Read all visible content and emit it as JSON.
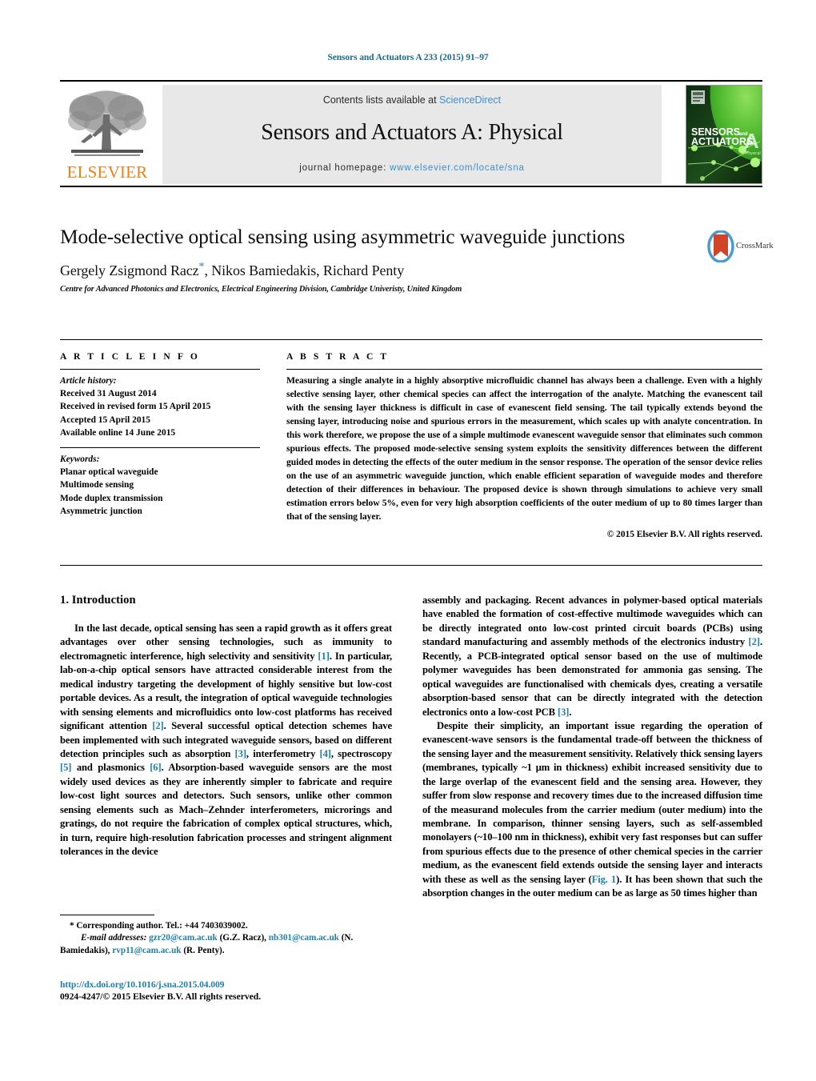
{
  "running_head": "Sensors and Actuators A 233 (2015) 91–97",
  "masthead": {
    "publisher_name": "ELSEVIER",
    "contents_prefix": "Contents lists available at ",
    "contents_link": "ScienceDirect",
    "journal_title": "Sensors and Actuators A: Physical",
    "homepage_label": "journal homepage: ",
    "homepage_url": "www.elsevier.com/locate/sna",
    "cover_line1": "SENSORS",
    "cover_and": "and",
    "cover_line2": "ACTUATORS",
    "cover_letter": "A",
    "cover_sub": "Physical",
    "accent_link_color": "#3e8ecc",
    "elsevier_orange": "#f07f1a"
  },
  "article": {
    "title": "Mode-selective optical sensing using asymmetric waveguide junctions",
    "authors": "Gergely Zsigmond Racz",
    "author_star": "*",
    "authors_rest": ", Nikos Bamiedakis, Richard Penty",
    "affiliation": "Centre for Advanced Photonics and Electronics, Electrical Engineering Division, Cambridge Univeristy, United Kingdom",
    "crossmark_label": "CrossMark"
  },
  "article_info": {
    "heading": "A R T I C L E   I N F O",
    "history_label": "Article history:",
    "history": [
      "Received 31 August 2014",
      "Received in revised form 15 April 2015",
      "Accepted 15 April 2015",
      "Available online 14 June 2015"
    ],
    "keywords_label": "Keywords:",
    "keywords": [
      "Planar optical waveguide",
      "Multimode sensing",
      "Mode duplex transmission",
      "Asymmetric junction"
    ]
  },
  "abstract": {
    "heading": "A B S T R A C T",
    "text": "Measuring a single analyte in a highly absorptive microfluidic channel has always been a challenge. Even with a highly selective sensing layer, other chemical species can affect the interrogation of the analyte. Matching the evanescent tail with the sensing layer thickness is difficult in case of evanescent field sensing. The tail typically extends beyond the sensing layer, introducing noise and spurious errors in the measurement, which scales up with analyte concentration. In this work therefore, we propose the use of a simple multimode evanescent waveguide sensor that eliminates such common spurious effects. The proposed mode-selective sensing system exploits the sensitivity differences between the different guided modes in detecting the effects of the outer medium in the sensor response. The operation of the sensor device relies on the use of an asymmetric waveguide junction, which enable efficient separation of waveguide modes and therefore detection of their differences in behaviour. The proposed device is shown through simulations to achieve very small estimation errors below 5%, even for very high absorption coefficients of the outer medium of up to 80 times larger than that of the sensing layer.",
    "copyright": "© 2015 Elsevier B.V. All rights reserved."
  },
  "body": {
    "section_heading": "1.  Introduction",
    "left_para_1_a": "In the last decade, optical sensing has seen a rapid growth as it offers great advantages over other sensing technologies, such as immunity to electromagnetic interference, high selectivity and sensitivity ",
    "ref1": "[1]",
    "left_para_1_b": ". In particular, lab-on-a-chip optical sensors have attracted considerable interest from the medical industry targeting the development of highly sensitive but low-cost portable devices. As a result, the integration of optical waveguide technologies with sensing elements and microfluidics onto low-cost platforms has received significant attention ",
    "ref2": "[2]",
    "left_para_1_c": ". Several successful optical detection schemes have been implemented with such integrated waveguide sensors, based on different detection principles such as absorption ",
    "ref3": "[3]",
    "left_para_1_d": ", interferometry ",
    "ref4": "[4]",
    "left_para_1_e": ", spectroscopy ",
    "ref5": "[5]",
    "left_para_1_f": " and plasmonics ",
    "ref6": "[6]",
    "left_para_1_g": ". Absorption-based waveguide sensors are the most widely used devices as they are inherently simpler to fabricate and require low-cost light sources and detectors. Such sensors, unlike other common sensing elements such as Mach–Zehnder interferometers, microrings and gratings, do not require the fabrication of complex optical structures, which, in turn, require high-resolution fabrication processes and stringent alignment tolerances in the device",
    "right_para_1_a": "assembly and packaging. Recent advances in polymer-based optical materials have enabled the formation of cost-effective multimode waveguides which can be directly integrated onto low-cost printed circuit boards (PCBs) using standard manufacturing and assembly methods of the electronics industry ",
    "right_ref2": "[2]",
    "right_para_1_b": ". Recently, a PCB-integrated optical sensor based on the use of multimode polymer waveguides has been demonstrated for ammonia gas sensing. The optical waveguides are functionalised with chemicals dyes, creating a versatile absorption-based sensor that can be directly integrated with the detection electronics onto a low-cost PCB ",
    "right_ref3": "[3]",
    "right_para_1_c": ".",
    "right_para_2_a": "Despite their simplicity, an important issue regarding the operation of evanescent-wave sensors is the fundamental trade-off between the thickness of the sensing layer and the measurement sensitivity. Relatively thick sensing layers (membranes, typically ~1 μm in thickness) exhibit increased sensitivity due to the large overlap of the evanescent field and the sensing area. However, they suffer from slow response and recovery times due to the increased diffusion time of the measurand molecules from the carrier medium (outer medium) into the membrane. In comparison, thinner sensing layers, such as self-assembled monolayers (~10–100 nm in thickness), exhibit very fast responses but can suffer from spurious effects due to the presence of other chemical species in the carrier medium, as the evanescent field extends outside the sensing layer and interacts with these as well as the sensing layer (",
    "fig_ref": "Fig. 1",
    "right_para_2_b": "). It has been shown that such the absorption changes in the outer medium can be as large as 50 times higher than"
  },
  "footnote": {
    "star": "*",
    "corresponding": " Corresponding author. Tel.: +44 7403039002.",
    "email_label": "E-mail addresses:",
    "email1": "gzr20@cam.ac.uk",
    "email1_name": " (G.Z. Racz), ",
    "email2": "nb301@cam.ac.uk",
    "email2_name": " (N. Bamiedakis), ",
    "email3": "rvp11@cam.ac.uk",
    "email3_name": " (R. Penty)."
  },
  "doi": {
    "url": "http://dx.doi.org/10.1016/j.sna.2015.04.009",
    "issn_line": "0924-4247/© 2015 Elsevier B.V. All rights reserved."
  }
}
